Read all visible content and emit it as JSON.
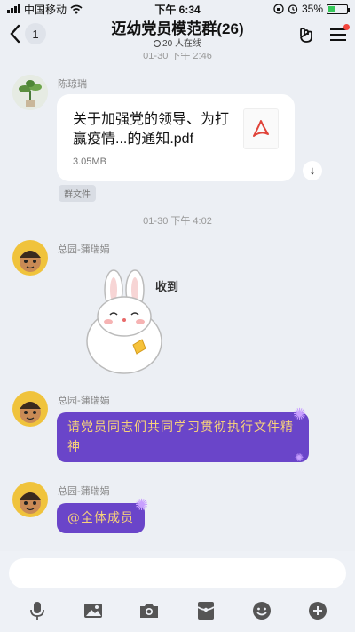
{
  "status_bar": {
    "carrier": "中国移动",
    "time": "下午 6:34",
    "battery": "35%",
    "battery_level": 0.35
  },
  "nav": {
    "back_count": "1",
    "title": "迈幼党员模范群(26)",
    "online": "20 人在线"
  },
  "timestamps": {
    "top_partial": "01-30 下午 2:46",
    "second": "01-30 下午 4:02"
  },
  "messages": {
    "file": {
      "sender": "陈琼瑞",
      "name": "关于加强党的领导、为打赢疫情...的通知.pdf",
      "size": "3.05MB",
      "tag": "群文件"
    },
    "sticker": {
      "sender": "总园-蒲瑞娟",
      "caption": "收到"
    },
    "text1": {
      "sender": "总园-蒲瑞娟",
      "text": "请党员同志们共同学习贯彻执行文件精神"
    },
    "text2": {
      "sender": "总园-蒲瑞娟",
      "text": "@全体成员"
    }
  },
  "colors": {
    "accent_purple": "#6a45c9",
    "bubble_text": "#f7d27a",
    "pdf_red": "#e0443a",
    "badge_red": "#f2453d"
  },
  "toolbar_icons": [
    "microphone-icon",
    "image-icon",
    "camera-icon",
    "red-packet-icon",
    "emoji-icon",
    "plus-icon"
  ]
}
